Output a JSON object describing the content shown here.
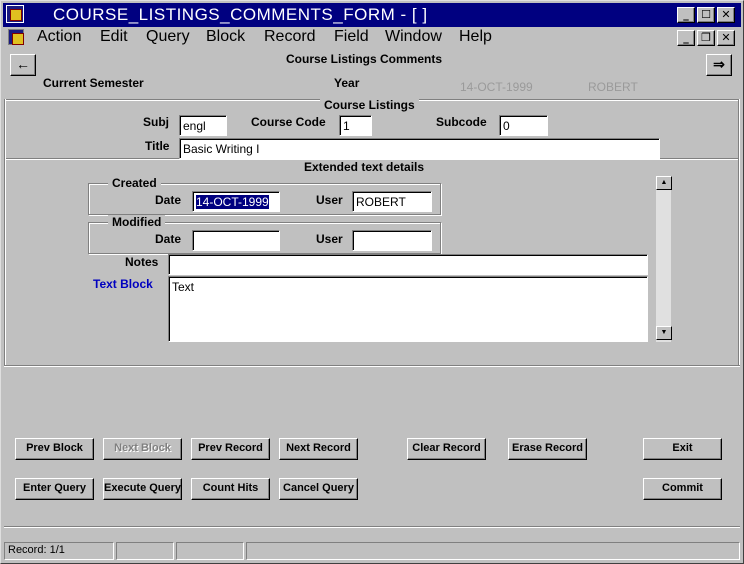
{
  "window": {
    "title": "COURSE_LISTINGS_COMMENTS_FORM - [ ]",
    "min_label": "_",
    "max_label": "☐",
    "close_label": "✕",
    "restore_label": "❐"
  },
  "menu": {
    "items": [
      {
        "label": "Action"
      },
      {
        "label": "Edit"
      },
      {
        "label": "Query"
      },
      {
        "label": "Block"
      },
      {
        "label": "Record"
      },
      {
        "label": "Field"
      },
      {
        "label": "Window"
      },
      {
        "label": "Help"
      }
    ]
  },
  "header": {
    "prev_arrow": "←",
    "next_arrow": "⇒",
    "form_title": "Course Listings Comments",
    "current_semester_label": "Current Semester",
    "year_label": "Year",
    "date_value": "14-OCT-1999",
    "user_value": "ROBERT"
  },
  "course_listings": {
    "section_title": "Course Listings",
    "subj_label": "Subj",
    "subj_value": "engl",
    "course_code_label": "Course Code",
    "course_code_value": "1",
    "subcode_label": "Subcode",
    "subcode_value": "0",
    "title_label": "Title",
    "title_value": "Basic Writing I"
  },
  "extended": {
    "section_title": "Extended text details",
    "created_group": "Created",
    "created_date_label": "Date",
    "created_date_value": "14-OCT-1999",
    "created_user_label": "User",
    "created_user_value": "ROBERT",
    "modified_group": "Modified",
    "modified_date_label": "Date",
    "modified_date_value": "",
    "modified_user_label": "User",
    "modified_user_value": "",
    "notes_label": "Notes",
    "notes_value": "",
    "text_block_label": "Text Block",
    "text_block_value": "Text",
    "text_block_label_color": "#0000c0"
  },
  "buttons": {
    "prev_block": "Prev Block",
    "next_block": "Next Block",
    "prev_record": "Prev Record",
    "next_record": "Next Record",
    "clear_record": "Clear Record",
    "erase_record": "Erase Record",
    "exit": "Exit",
    "enter_query": "Enter Query",
    "execute_query": "Execute Query",
    "count_hits": "Count Hits",
    "cancel_query": "Cancel Query",
    "commit": "Commit"
  },
  "status": {
    "record": "Record: 1/1"
  }
}
